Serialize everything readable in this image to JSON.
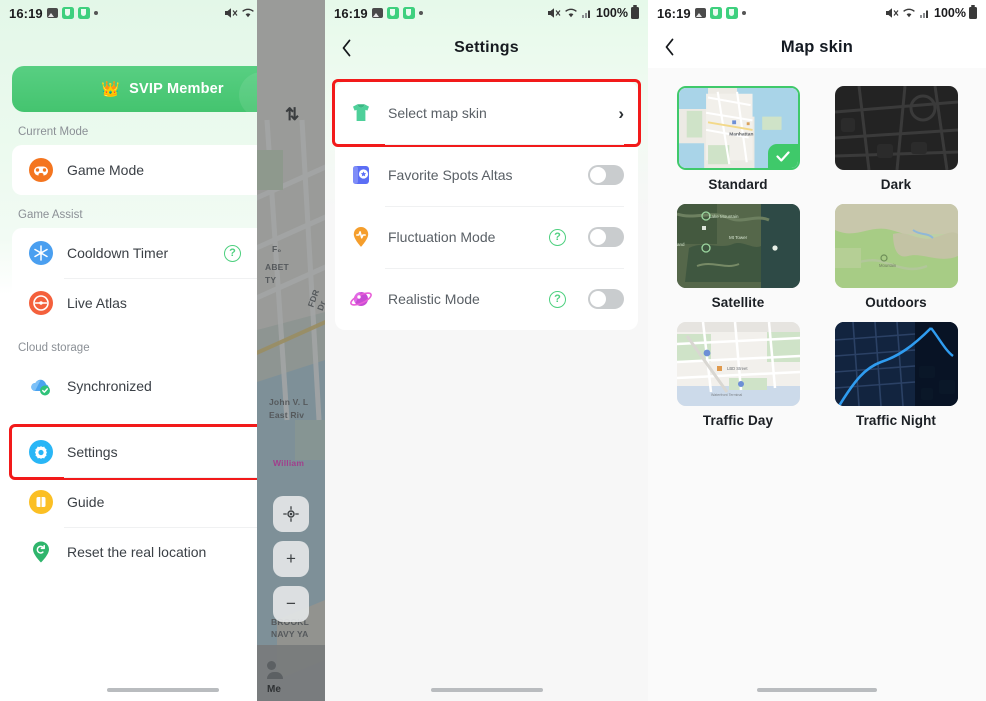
{
  "status_bar": {
    "time": "16:19",
    "battery_percent": "100%",
    "icons": [
      "photo-icon",
      "app-badge-icon",
      "app-badge-icon",
      "dot-icon",
      "mute-icon",
      "wifi-icon",
      "signal-icon",
      "battery-icon"
    ]
  },
  "panel1": {
    "back_label": "‹",
    "svip_banner": {
      "label": "SVIP Member",
      "icon": "crown-icon"
    },
    "sections": [
      {
        "title": "Current Mode",
        "rows": [
          {
            "label": "Game Mode",
            "icon": "gamepad-icon",
            "icon_color": "#f4751f",
            "control": "swap",
            "control_label": "≢"
          }
        ]
      },
      {
        "title": "Game Assist",
        "rows": [
          {
            "label": "Cooldown Timer",
            "icon": "snowflake-icon",
            "icon_color": "#4a9ff0",
            "control": "toggle-on",
            "help": "?"
          },
          {
            "label": "Live Atlas",
            "icon": "compass-icon",
            "icon_color": "#f4603c",
            "control": "toggle-on"
          }
        ]
      },
      {
        "title": "Cloud storage",
        "rows": [
          {
            "label": "Synchronized",
            "icon": "cloud-check-icon",
            "icon_color": "#4aa3f0",
            "control": "chevron",
            "control_label": "›"
          }
        ]
      },
      {
        "title": "",
        "rows": [
          {
            "label": "Settings",
            "icon": "gear-icon",
            "icon_color": "#29b6f6",
            "control": "chevron",
            "control_label": "›",
            "highlighted": true
          },
          {
            "label": "Guide",
            "icon": "book-icon",
            "icon_color": "#fbbf24",
            "control": "chevron",
            "control_label": "›"
          },
          {
            "label": "Reset the real location",
            "icon": "location-reset-icon",
            "icon_color": "#2fb56c",
            "control": "none"
          }
        ]
      }
    ],
    "map_strip": {
      "sort_icon": "sort-arrows-icon",
      "locate_icon": "locate-icon",
      "zoom_in": "+",
      "zoom_out": "−",
      "labels": [
        "F₀",
        "ABET",
        "TY",
        "FDR Dr",
        "John V. L",
        "East Riv",
        "William",
        "BROOKL",
        "NAVY YA"
      ],
      "tab_label": "Me"
    }
  },
  "panel2": {
    "nav": {
      "back_icon": "chevron-left-icon",
      "title": "Settings"
    },
    "rows": [
      {
        "label": "Select map skin",
        "icon": "tshirt-icon",
        "control": "chevron",
        "control_label": "›",
        "highlighted": true
      },
      {
        "label": "Favorite Spots Altas",
        "icon": "favorites-book-icon",
        "control": "toggle-off"
      },
      {
        "label": "Fluctuation Mode",
        "icon": "pulse-pin-icon",
        "control": "toggle-off",
        "help": "?"
      },
      {
        "label": "Realistic Mode",
        "icon": "planet-icon",
        "control": "toggle-off",
        "help": "?"
      }
    ]
  },
  "panel3": {
    "nav": {
      "back_icon": "chevron-left-icon",
      "title": "Map skin"
    },
    "skins": [
      {
        "name": "Standard",
        "selected": true
      },
      {
        "name": "Dark",
        "selected": false
      },
      {
        "name": "Satellite",
        "selected": false
      },
      {
        "name": "Outdoors",
        "selected": false
      },
      {
        "name": "Traffic Day",
        "selected": false
      },
      {
        "name": "Traffic Night",
        "selected": false
      }
    ]
  },
  "colors": {
    "accent_green": "#4ed07f",
    "highlight_red": "#f21a1a",
    "toggle_off": "#c9ccce"
  }
}
